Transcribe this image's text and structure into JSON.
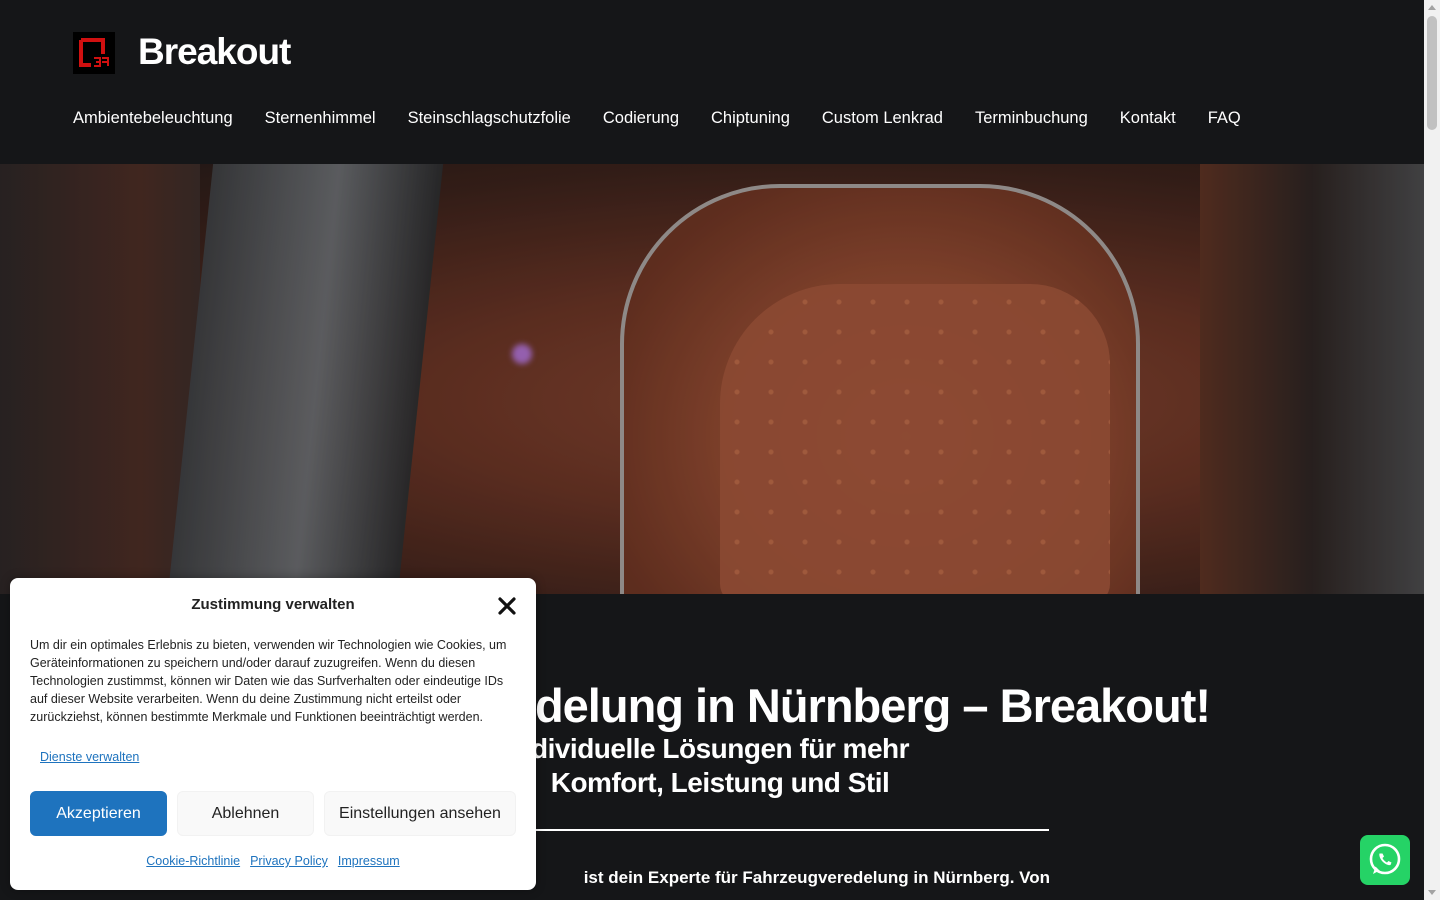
{
  "header": {
    "site_title": "Breakout",
    "logo_icon": "breakout-logo-icon",
    "nav": [
      {
        "label": "Ambientebeleuchtung"
      },
      {
        "label": "Sternenhimmel"
      },
      {
        "label": "Steinschlagschutzfolie"
      },
      {
        "label": "Codierung"
      },
      {
        "label": "Chiptuning"
      },
      {
        "label": "Custom Lenkrad"
      },
      {
        "label": "Terminbuchung"
      },
      {
        "label": "Kontakt"
      },
      {
        "label": "FAQ"
      }
    ]
  },
  "hero": {
    "image_subject": "orange leather car seat interior"
  },
  "main": {
    "headline_visible": "delung in Nürnberg – Breakout!",
    "subheadline_line1": "dividuelle Lösungen für mehr",
    "subheadline_line2": "Komfort, Leistung und Stil",
    "intro_visible": "ist dein Experte für Fahrzeugveredelung in Nürnberg. Von"
  },
  "cookie_banner": {
    "title": "Zustimmung verwalten",
    "text": "Um dir ein optimales Erlebnis zu bieten, verwenden wir Technologien wie Cookies, um Geräteinformationen zu speichern und/oder darauf zuzugreifen. Wenn du diesen Technologien zustimmst, können wir Daten wie das Surfverhalten oder eindeutige IDs auf dieser Website verarbeiten. Wenn du deine Zustimmung nicht erteilst oder zurückziehst, können bestimmte Merkmale und Funktionen beeinträchtigt werden.",
    "manage_link": "Dienste verwalten",
    "accept_label": "Akzeptieren",
    "deny_label": "Ablehnen",
    "preferences_label": "Einstellungen ansehen",
    "links": [
      {
        "label": "Cookie-Richtlinie"
      },
      {
        "label": "Privacy Policy"
      },
      {
        "label": "Impressum"
      }
    ]
  },
  "colors": {
    "background": "#151618",
    "accent": "#1e73be",
    "whatsapp": "#25d366"
  }
}
